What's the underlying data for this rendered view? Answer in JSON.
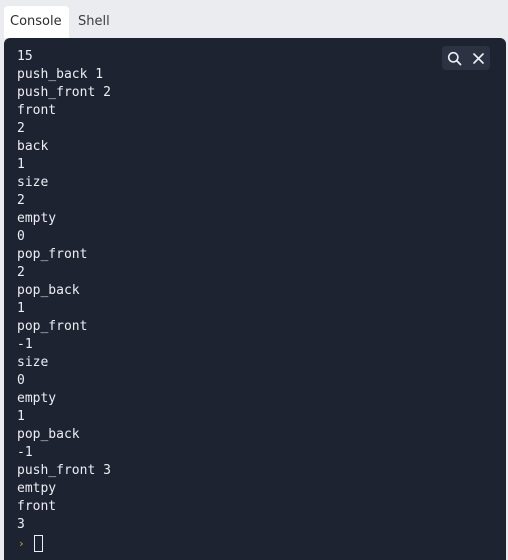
{
  "tabs": [
    {
      "label": "Console",
      "active": true
    },
    {
      "label": "Shell",
      "active": false
    }
  ],
  "console": {
    "output_lines": [
      "15",
      "push_back 1",
      "push_front 2",
      "front",
      "2",
      "back",
      "1",
      "size",
      "2",
      "empty",
      "0",
      "pop_front",
      "2",
      "pop_back",
      "1",
      "pop_front",
      "-1",
      "size",
      "0",
      "empty",
      "1",
      "pop_back",
      "-1",
      "push_front 3",
      "emtpy",
      "front",
      "3"
    ],
    "prompt_symbol": "›",
    "icons": {
      "search": "search-icon",
      "close": "close-icon"
    }
  },
  "colors": {
    "console_bg": "#1e2331",
    "console_text": "#eceef3",
    "prompt": "#d4a72c",
    "tabbar_bg": "#ebecf0"
  }
}
